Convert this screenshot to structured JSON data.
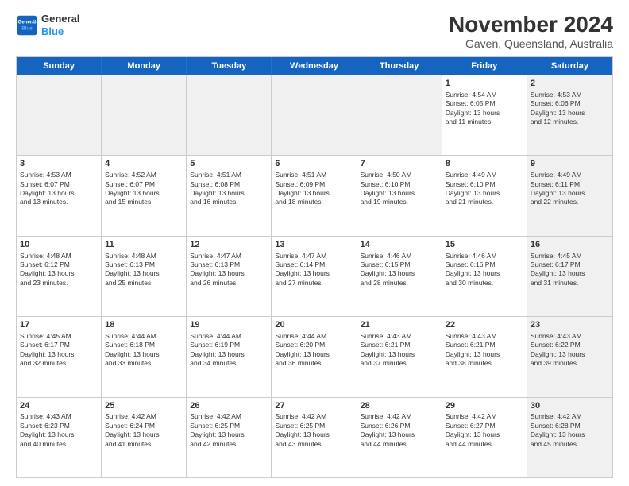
{
  "logo": {
    "line1": "General",
    "line2": "Blue"
  },
  "title": "November 2024",
  "location": "Gaven, Queensland, Australia",
  "header_days": [
    "Sunday",
    "Monday",
    "Tuesday",
    "Wednesday",
    "Thursday",
    "Friday",
    "Saturday"
  ],
  "weeks": [
    [
      {
        "day": "",
        "content": "",
        "shaded": true
      },
      {
        "day": "",
        "content": "",
        "shaded": true
      },
      {
        "day": "",
        "content": "",
        "shaded": true
      },
      {
        "day": "",
        "content": "",
        "shaded": true
      },
      {
        "day": "",
        "content": "",
        "shaded": true
      },
      {
        "day": "1",
        "content": "Sunrise: 4:54 AM\nSunset: 6:05 PM\nDaylight: 13 hours\nand 11 minutes.",
        "shaded": false
      },
      {
        "day": "2",
        "content": "Sunrise: 4:53 AM\nSunset: 6:06 PM\nDaylight: 13 hours\nand 12 minutes.",
        "shaded": true
      }
    ],
    [
      {
        "day": "3",
        "content": "Sunrise: 4:53 AM\nSunset: 6:07 PM\nDaylight: 13 hours\nand 13 minutes.",
        "shaded": false
      },
      {
        "day": "4",
        "content": "Sunrise: 4:52 AM\nSunset: 6:07 PM\nDaylight: 13 hours\nand 15 minutes.",
        "shaded": false
      },
      {
        "day": "5",
        "content": "Sunrise: 4:51 AM\nSunset: 6:08 PM\nDaylight: 13 hours\nand 16 minutes.",
        "shaded": false
      },
      {
        "day": "6",
        "content": "Sunrise: 4:51 AM\nSunset: 6:09 PM\nDaylight: 13 hours\nand 18 minutes.",
        "shaded": false
      },
      {
        "day": "7",
        "content": "Sunrise: 4:50 AM\nSunset: 6:10 PM\nDaylight: 13 hours\nand 19 minutes.",
        "shaded": false
      },
      {
        "day": "8",
        "content": "Sunrise: 4:49 AM\nSunset: 6:10 PM\nDaylight: 13 hours\nand 21 minutes.",
        "shaded": false
      },
      {
        "day": "9",
        "content": "Sunrise: 4:49 AM\nSunset: 6:11 PM\nDaylight: 13 hours\nand 22 minutes.",
        "shaded": true
      }
    ],
    [
      {
        "day": "10",
        "content": "Sunrise: 4:48 AM\nSunset: 6:12 PM\nDaylight: 13 hours\nand 23 minutes.",
        "shaded": false
      },
      {
        "day": "11",
        "content": "Sunrise: 4:48 AM\nSunset: 6:13 PM\nDaylight: 13 hours\nand 25 minutes.",
        "shaded": false
      },
      {
        "day": "12",
        "content": "Sunrise: 4:47 AM\nSunset: 6:13 PM\nDaylight: 13 hours\nand 26 minutes.",
        "shaded": false
      },
      {
        "day": "13",
        "content": "Sunrise: 4:47 AM\nSunset: 6:14 PM\nDaylight: 13 hours\nand 27 minutes.",
        "shaded": false
      },
      {
        "day": "14",
        "content": "Sunrise: 4:46 AM\nSunset: 6:15 PM\nDaylight: 13 hours\nand 28 minutes.",
        "shaded": false
      },
      {
        "day": "15",
        "content": "Sunrise: 4:46 AM\nSunset: 6:16 PM\nDaylight: 13 hours\nand 30 minutes.",
        "shaded": false
      },
      {
        "day": "16",
        "content": "Sunrise: 4:45 AM\nSunset: 6:17 PM\nDaylight: 13 hours\nand 31 minutes.",
        "shaded": true
      }
    ],
    [
      {
        "day": "17",
        "content": "Sunrise: 4:45 AM\nSunset: 6:17 PM\nDaylight: 13 hours\nand 32 minutes.",
        "shaded": false
      },
      {
        "day": "18",
        "content": "Sunrise: 4:44 AM\nSunset: 6:18 PM\nDaylight: 13 hours\nand 33 minutes.",
        "shaded": false
      },
      {
        "day": "19",
        "content": "Sunrise: 4:44 AM\nSunset: 6:19 PM\nDaylight: 13 hours\nand 34 minutes.",
        "shaded": false
      },
      {
        "day": "20",
        "content": "Sunrise: 4:44 AM\nSunset: 6:20 PM\nDaylight: 13 hours\nand 36 minutes.",
        "shaded": false
      },
      {
        "day": "21",
        "content": "Sunrise: 4:43 AM\nSunset: 6:21 PM\nDaylight: 13 hours\nand 37 minutes.",
        "shaded": false
      },
      {
        "day": "22",
        "content": "Sunrise: 4:43 AM\nSunset: 6:21 PM\nDaylight: 13 hours\nand 38 minutes.",
        "shaded": false
      },
      {
        "day": "23",
        "content": "Sunrise: 4:43 AM\nSunset: 6:22 PM\nDaylight: 13 hours\nand 39 minutes.",
        "shaded": true
      }
    ],
    [
      {
        "day": "24",
        "content": "Sunrise: 4:43 AM\nSunset: 6:23 PM\nDaylight: 13 hours\nand 40 minutes.",
        "shaded": false
      },
      {
        "day": "25",
        "content": "Sunrise: 4:42 AM\nSunset: 6:24 PM\nDaylight: 13 hours\nand 41 minutes.",
        "shaded": false
      },
      {
        "day": "26",
        "content": "Sunrise: 4:42 AM\nSunset: 6:25 PM\nDaylight: 13 hours\nand 42 minutes.",
        "shaded": false
      },
      {
        "day": "27",
        "content": "Sunrise: 4:42 AM\nSunset: 6:25 PM\nDaylight: 13 hours\nand 43 minutes.",
        "shaded": false
      },
      {
        "day": "28",
        "content": "Sunrise: 4:42 AM\nSunset: 6:26 PM\nDaylight: 13 hours\nand 44 minutes.",
        "shaded": false
      },
      {
        "day": "29",
        "content": "Sunrise: 4:42 AM\nSunset: 6:27 PM\nDaylight: 13 hours\nand 44 minutes.",
        "shaded": false
      },
      {
        "day": "30",
        "content": "Sunrise: 4:42 AM\nSunset: 6:28 PM\nDaylight: 13 hours\nand 45 minutes.",
        "shaded": true
      }
    ]
  ]
}
